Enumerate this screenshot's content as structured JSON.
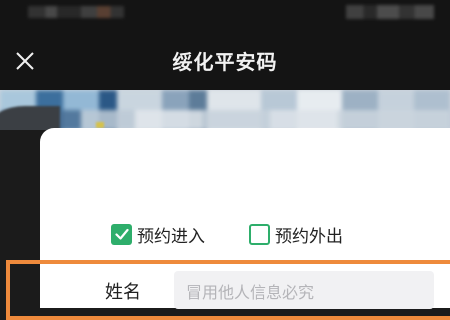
{
  "window": {
    "title": "绥化平安码"
  },
  "icons": {
    "close": "close-icon",
    "check": "checkmark-icon"
  },
  "colors": {
    "accent": "#2eae6b",
    "highlight": "#ee8a3c",
    "header_bg": "#141414"
  },
  "form": {
    "options": [
      {
        "label": "预约进入",
        "checked": true
      },
      {
        "label": "预约外出",
        "checked": false
      }
    ],
    "name_field": {
      "label": "姓名",
      "placeholder": "冒用他人信息必究",
      "value": ""
    }
  }
}
